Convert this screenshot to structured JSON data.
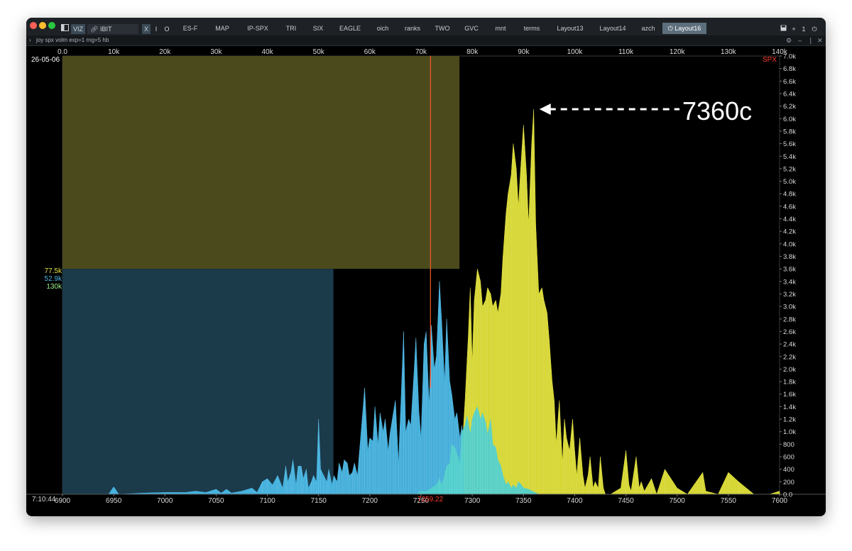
{
  "window": {
    "toolbar": {
      "viz_label": "VIZ",
      "ticker_value": "IBIT",
      "mode_buttons": [
        "X",
        "I",
        "O"
      ],
      "right_buttons": [
        "+",
        "1"
      ]
    },
    "tabs": [
      {
        "label": "ES-F",
        "active": false
      },
      {
        "label": "MAP",
        "active": false
      },
      {
        "label": "IP-SPX",
        "active": false
      },
      {
        "label": "TRI",
        "active": false
      },
      {
        "label": "SIX",
        "active": false
      },
      {
        "label": "EAGLE",
        "active": false
      },
      {
        "label": "oich",
        "active": false
      },
      {
        "label": "ranks",
        "active": false
      },
      {
        "label": "TWO",
        "active": false
      },
      {
        "label": "GVC",
        "active": false
      },
      {
        "label": "mnt",
        "active": false
      },
      {
        "label": "terms",
        "active": false
      },
      {
        "label": "Layout13",
        "active": false
      },
      {
        "label": "Layout14",
        "active": false
      },
      {
        "label": "azch",
        "active": false
      },
      {
        "label": "Layout16",
        "active": true
      }
    ],
    "command": "joy spx volm exp=1 rng=5 hb",
    "colors": {
      "window_bg": "#000000",
      "tabbar_bg": "#1e2226",
      "active_tab": "#5d6f7d",
      "calls": "#e3e33a",
      "puts": "#4ab8e6",
      "overlap": "#52d0cc",
      "call_total_box": "#4a4a1c",
      "put_total_box": "#1b3a4a",
      "spot_line": "#ff5a2a",
      "price_label": "#ff3b30"
    },
    "icons": [
      "sidebar-toggle-icon",
      "link-icon",
      "save-icon",
      "power-icon",
      "settings-icon",
      "minimize-icon",
      "close-icon"
    ]
  },
  "chart_data": {
    "type": "area",
    "date": "26-05-06",
    "time": "7:10:44",
    "symbol": "SPX",
    "annotation": "7360c",
    "spot_price": 7259.22,
    "spot_price_label": "7259.22",
    "x_strike_range": [
      6900,
      7600
    ],
    "x_strike_ticks": [
      "6900",
      "6950",
      "7000",
      "7050",
      "7100",
      "7150",
      "7200",
      "7250",
      "7300",
      "7350",
      "7400",
      "7450",
      "7500",
      "7550",
      "7600"
    ],
    "x_total_range": [
      0,
      140000
    ],
    "x_total_ticks": [
      "0.0",
      "10k",
      "20k",
      "30k",
      "40k",
      "50k",
      "60k",
      "70k",
      "80k",
      "90k",
      "100k",
      "110k",
      "120k",
      "130k",
      "140k"
    ],
    "y_range": [
      0,
      7000
    ],
    "y_ticks": [
      "0.0",
      "200",
      "400",
      "600",
      "800",
      "1.0k",
      "1.2k",
      "1.4k",
      "1.6k",
      "1.8k",
      "2.0k",
      "2.2k",
      "2.4k",
      "2.6k",
      "2.8k",
      "3.0k",
      "3.2k",
      "3.4k",
      "3.6k",
      "3.8k",
      "4.0k",
      "4.2k",
      "4.4k",
      "4.6k",
      "4.8k",
      "5.0k",
      "5.2k",
      "5.4k",
      "5.6k",
      "5.8k",
      "6.0k",
      "6.2k",
      "6.4k",
      "6.6k",
      "6.8k",
      "7.0k"
    ],
    "totals": [
      {
        "name": "calls",
        "label": "77.5k",
        "value": 77500
      },
      {
        "name": "puts",
        "label": "52.9k",
        "value": 52900
      },
      {
        "name": "all",
        "label": "130k",
        "value": 130000
      }
    ],
    "series": [
      {
        "name": "calls",
        "points": [
          [
            7275,
            0
          ],
          [
            7280,
            100
          ],
          [
            7285,
            300
          ],
          [
            7290,
            700
          ],
          [
            7293,
            1500
          ],
          [
            7296,
            2500
          ],
          [
            7298,
            3300
          ],
          [
            7300,
            2100
          ],
          [
            7302,
            3100
          ],
          [
            7305,
            3600
          ],
          [
            7308,
            3400
          ],
          [
            7310,
            3000
          ],
          [
            7313,
            3100
          ],
          [
            7315,
            3300
          ],
          [
            7318,
            3200
          ],
          [
            7320,
            3000
          ],
          [
            7323,
            3100
          ],
          [
            7325,
            2900
          ],
          [
            7328,
            3200
          ],
          [
            7330,
            3800
          ],
          [
            7333,
            4500
          ],
          [
            7335,
            4800
          ],
          [
            7338,
            5100
          ],
          [
            7340,
            5600
          ],
          [
            7343,
            5200
          ],
          [
            7345,
            4600
          ],
          [
            7348,
            5400
          ],
          [
            7350,
            5900
          ],
          [
            7353,
            5100
          ],
          [
            7355,
            4300
          ],
          [
            7358,
            5600
          ],
          [
            7360,
            6150
          ],
          [
            7362,
            4300
          ],
          [
            7365,
            3200
          ],
          [
            7368,
            3300
          ],
          [
            7370,
            3100
          ],
          [
            7373,
            2900
          ],
          [
            7375,
            2500
          ],
          [
            7378,
            1800
          ],
          [
            7380,
            1500
          ],
          [
            7382,
            800
          ],
          [
            7385,
            1500
          ],
          [
            7388,
            500
          ],
          [
            7390,
            1200
          ],
          [
            7392,
            900
          ],
          [
            7395,
            700
          ],
          [
            7398,
            1200
          ],
          [
            7400,
            700
          ],
          [
            7402,
            300
          ],
          [
            7405,
            900
          ],
          [
            7408,
            300
          ],
          [
            7410,
            100
          ],
          [
            7413,
            300
          ],
          [
            7415,
            600
          ],
          [
            7418,
            100
          ],
          [
            7420,
            200
          ],
          [
            7423,
            100
          ],
          [
            7425,
            600
          ],
          [
            7428,
            100
          ],
          [
            7430,
            0
          ],
          [
            7435,
            0
          ],
          [
            7440,
            50
          ],
          [
            7445,
            100
          ],
          [
            7450,
            700
          ],
          [
            7453,
            150
          ],
          [
            7455,
            50
          ],
          [
            7460,
            600
          ],
          [
            7463,
            100
          ],
          [
            7465,
            200
          ],
          [
            7468,
            50
          ],
          [
            7475,
            250
          ],
          [
            7478,
            100
          ],
          [
            7480,
            0
          ],
          [
            7488,
            400
          ],
          [
            7500,
            100
          ],
          [
            7510,
            0
          ],
          [
            7525,
            350
          ],
          [
            7528,
            50
          ],
          [
            7540,
            0
          ],
          [
            7550,
            350
          ],
          [
            7560,
            200
          ],
          [
            7575,
            0
          ],
          [
            7590,
            0
          ],
          [
            7600,
            50
          ]
        ]
      },
      {
        "name": "puts",
        "points": [
          [
            6900,
            0
          ],
          [
            6945,
            0
          ],
          [
            6950,
            120
          ],
          [
            6955,
            0
          ],
          [
            6980,
            20
          ],
          [
            7000,
            30
          ],
          [
            7020,
            30
          ],
          [
            7030,
            50
          ],
          [
            7040,
            30
          ],
          [
            7050,
            80
          ],
          [
            7055,
            20
          ],
          [
            7060,
            80
          ],
          [
            7065,
            20
          ],
          [
            7075,
            50
          ],
          [
            7085,
            100
          ],
          [
            7090,
            30
          ],
          [
            7095,
            200
          ],
          [
            7100,
            250
          ],
          [
            7105,
            150
          ],
          [
            7110,
            300
          ],
          [
            7115,
            100
          ],
          [
            7118,
            450
          ],
          [
            7120,
            200
          ],
          [
            7123,
            350
          ],
          [
            7125,
            550
          ],
          [
            7128,
            150
          ],
          [
            7130,
            450
          ],
          [
            7133,
            450
          ],
          [
            7135,
            250
          ],
          [
            7138,
            400
          ],
          [
            7140,
            100
          ],
          [
            7143,
            200
          ],
          [
            7145,
            300
          ],
          [
            7148,
            200
          ],
          [
            7150,
            1200
          ],
          [
            7152,
            400
          ],
          [
            7155,
            300
          ],
          [
            7158,
            200
          ],
          [
            7160,
            400
          ],
          [
            7163,
            150
          ],
          [
            7165,
            300
          ],
          [
            7168,
            200
          ],
          [
            7170,
            500
          ],
          [
            7173,
            350
          ],
          [
            7175,
            550
          ],
          [
            7178,
            500
          ],
          [
            7180,
            300
          ],
          [
            7183,
            350
          ],
          [
            7185,
            500
          ],
          [
            7188,
            300
          ],
          [
            7190,
            700
          ],
          [
            7193,
            1300
          ],
          [
            7195,
            1700
          ],
          [
            7198,
            700
          ],
          [
            7200,
            900
          ],
          [
            7203,
            850
          ],
          [
            7205,
            1400
          ],
          [
            7208,
            800
          ],
          [
            7210,
            1300
          ],
          [
            7213,
            1000
          ],
          [
            7215,
            1200
          ],
          [
            7218,
            700
          ],
          [
            7220,
            1000
          ],
          [
            7223,
            1300
          ],
          [
            7225,
            1500
          ],
          [
            7228,
            500
          ],
          [
            7230,
            1300
          ],
          [
            7233,
            2600
          ],
          [
            7235,
            1000
          ],
          [
            7238,
            1200
          ],
          [
            7240,
            1100
          ],
          [
            7243,
            1900
          ],
          [
            7245,
            2500
          ],
          [
            7248,
            1300
          ],
          [
            7250,
            900
          ],
          [
            7253,
            2400
          ],
          [
            7255,
            2600
          ],
          [
            7258,
            1400
          ],
          [
            7260,
            2700
          ],
          [
            7263,
            2000
          ],
          [
            7265,
            2200
          ],
          [
            7268,
            3400
          ],
          [
            7270,
            2800
          ],
          [
            7273,
            1800
          ],
          [
            7275,
            2800
          ],
          [
            7278,
            1800
          ],
          [
            7280,
            1600
          ],
          [
            7283,
            1200
          ],
          [
            7285,
            1300
          ],
          [
            7288,
            900
          ],
          [
            7290,
            1100
          ],
          [
            7292,
            0
          ]
        ]
      },
      {
        "name": "overlap",
        "points": [
          [
            7245,
            0
          ],
          [
            7250,
            50
          ],
          [
            7255,
            40
          ],
          [
            7260,
            100
          ],
          [
            7265,
            150
          ],
          [
            7268,
            250
          ],
          [
            7270,
            150
          ],
          [
            7273,
            300
          ],
          [
            7275,
            450
          ],
          [
            7278,
            500
          ],
          [
            7280,
            800
          ],
          [
            7283,
            750
          ],
          [
            7285,
            650
          ],
          [
            7288,
            500
          ],
          [
            7290,
            1000
          ],
          [
            7293,
            1100
          ],
          [
            7295,
            1250
          ],
          [
            7298,
            950
          ],
          [
            7300,
            1200
          ],
          [
            7302,
            1300
          ],
          [
            7305,
            1400
          ],
          [
            7308,
            1200
          ],
          [
            7310,
            1300
          ],
          [
            7313,
            1150
          ],
          [
            7315,
            950
          ],
          [
            7318,
            1200
          ],
          [
            7320,
            800
          ],
          [
            7323,
            750
          ],
          [
            7325,
            550
          ],
          [
            7328,
            450
          ],
          [
            7330,
            300
          ],
          [
            7333,
            150
          ],
          [
            7335,
            200
          ],
          [
            7338,
            100
          ],
          [
            7340,
            150
          ],
          [
            7343,
            100
          ],
          [
            7345,
            200
          ],
          [
            7348,
            150
          ],
          [
            7350,
            100
          ],
          [
            7355,
            80
          ],
          [
            7360,
            40
          ],
          [
            7365,
            0
          ]
        ]
      }
    ]
  }
}
